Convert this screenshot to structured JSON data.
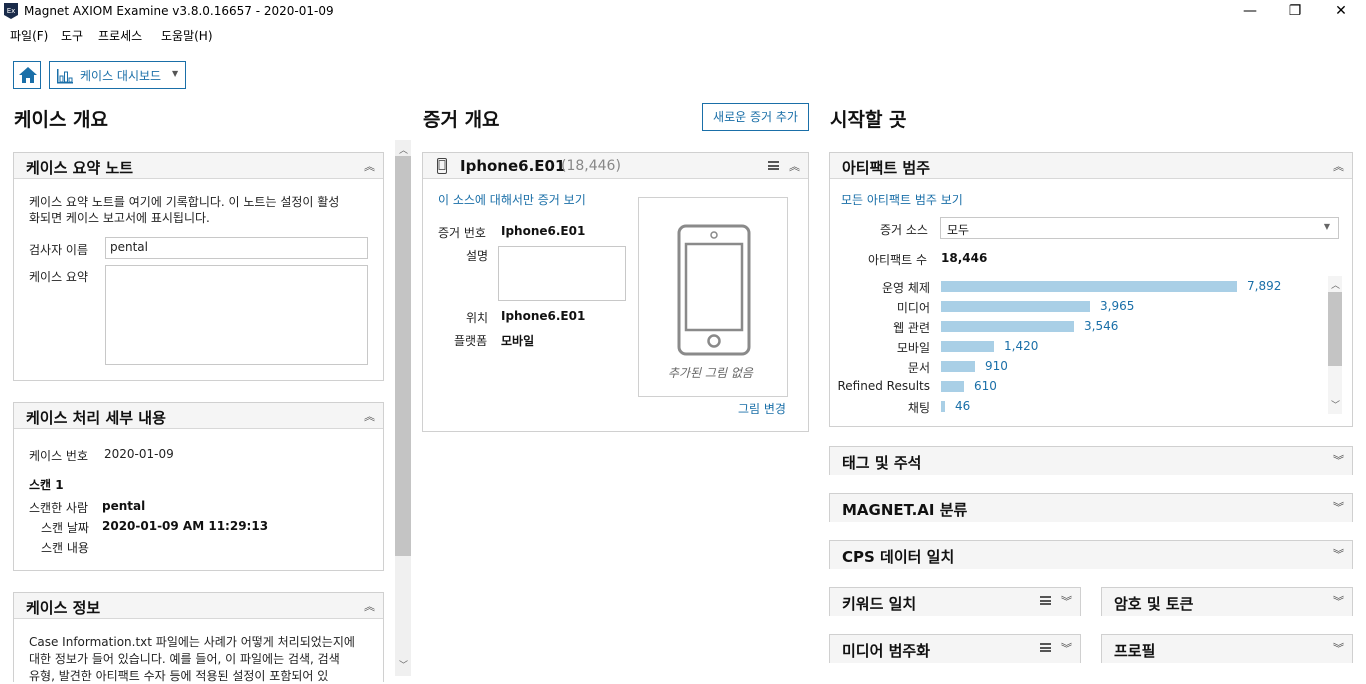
{
  "window": {
    "icon_text": "Ex",
    "title": "Magnet AXIOM Examine v3.8.0.16657 - 2020-01-09",
    "minimize": "—",
    "maximize": "❐",
    "close": "✕"
  },
  "menu": {
    "items": [
      {
        "label": "파일(F)"
      },
      {
        "label": "도구"
      },
      {
        "label": "프로세스"
      },
      {
        "label": "도움말(H)"
      }
    ]
  },
  "toolbar": {
    "dashboard_label": "케이스 대시보드"
  },
  "left": {
    "heading": "케이스 개요",
    "notes": {
      "title": "케이스 요약 노트",
      "description_line1": "케이스 요약 노트를 여기에 기록합니다. 이 노트는 설정이 활성",
      "description_line2": "화되면 케이스 보고서에 표시됩니다.",
      "examiner_label": "검사자 이름",
      "examiner_value": "pental",
      "summary_label": "케이스 요약",
      "summary_value": ""
    },
    "processing": {
      "title": "케이스 처리 세부 내용",
      "case_number_label": "케이스 번호",
      "case_number_value": "2020-01-09",
      "scan_title": "스캔 1",
      "scanned_by_label": "스캔한 사람",
      "scanned_by_value": "pental",
      "scan_date_label": "스캔 날짜",
      "scan_date_value": "2020-01-09 AM 11:29:13",
      "scan_content_label": "스캔 내용"
    },
    "info": {
      "title": "케이스 정보",
      "text_line1": "Case Information.txt 파일에는 사례가 어떻게 처리되었는지에",
      "text_line2": "대한 정보가 들어 있습니다. 예를 들어, 이 파일에는 검색, 검색",
      "text_line3": "유형, 발견한 아티팩트 수자 등에 적용된 설정이 포함되어 있"
    }
  },
  "middle": {
    "heading": "증거 개요",
    "add_evidence_label": "새로운 증거 추가",
    "evidence": {
      "name": "Iphone6.E01",
      "count": "(18,446)",
      "filter_link": "이 소스에 대해서만 증거 보기",
      "number_label": "증거 번호",
      "number_value": "Iphone6.E01",
      "desc_label": "설명",
      "location_label": "위치",
      "location_value": "Iphone6.E01",
      "platform_label": "플랫폼",
      "platform_value": "모바일",
      "no_image_label": "추가된 그림 없음",
      "change_image_link": "그림 변경"
    }
  },
  "right": {
    "heading": "시작할 곳",
    "artifacts": {
      "title": "아티팩트 범주",
      "view_all_link": "모든 아티팩트 범주 보기",
      "source_label": "증거 소스",
      "source_value": "모두",
      "count_label": "아티팩트 수",
      "count_value": "18,446",
      "categories": [
        {
          "label": "운영 체제",
          "value": 7892,
          "display": "7,892"
        },
        {
          "label": "미디어",
          "value": 3965,
          "display": "3,965"
        },
        {
          "label": "웹 관련",
          "value": 3546,
          "display": "3,546"
        },
        {
          "label": "모바일",
          "value": 1420,
          "display": "1,420"
        },
        {
          "label": "문서",
          "value": 910,
          "display": "910"
        },
        {
          "label": "Refined Results",
          "value": 610,
          "display": "610"
        },
        {
          "label": "채팅",
          "value": 46,
          "display": "46"
        }
      ]
    },
    "collapsed_panels": {
      "tags": "태그 및 주석",
      "magnet_ai": "MAGNET.AI 분류",
      "cps": "CPS 데이터 일치",
      "keywords": "키워드 일치",
      "passwords": "암호 및 토큰",
      "media": "미디어 범주화",
      "profiles": "프로필"
    }
  },
  "colors": {
    "accent": "#1a6fa8",
    "bar": "#a9cfe6"
  }
}
